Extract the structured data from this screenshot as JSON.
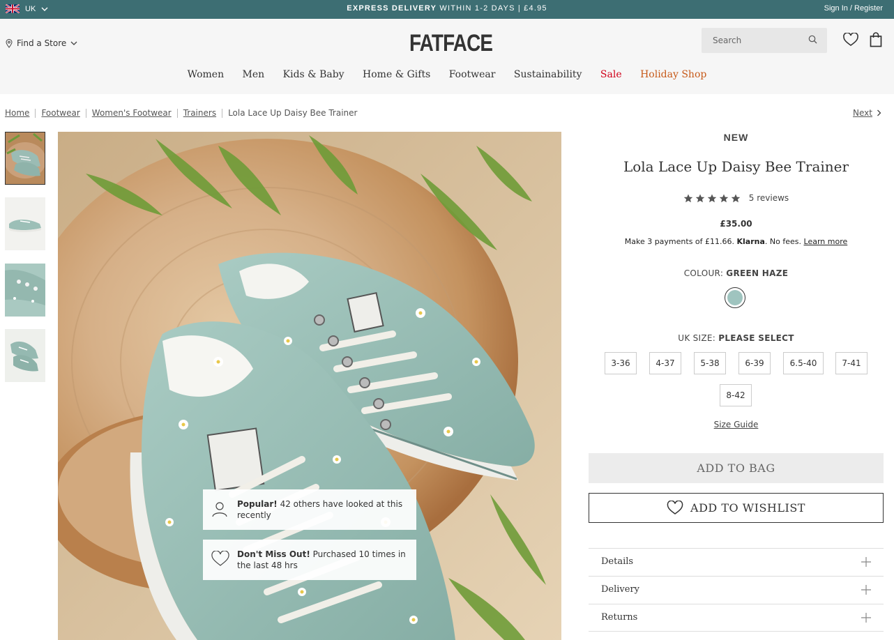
{
  "topbar": {
    "locale": "UK",
    "promo_bold": "EXPRESS DELIVERY",
    "promo_rest": " WITHIN 1-2 DAYS | £4.95",
    "signin": "Sign In / Register"
  },
  "header": {
    "find_store": "Find a Store",
    "logo": "FATFACE",
    "search_placeholder": "Search",
    "nav": [
      "Women",
      "Men",
      "Kids & Baby",
      "Home & Gifts",
      "Footwear",
      "Sustainability",
      "Sale",
      "Holiday Shop"
    ]
  },
  "breadcrumb": {
    "items": [
      "Home",
      "Footwear",
      "Women's Footwear",
      "Trainers",
      "Lola Lace Up Daisy Bee Trainer"
    ],
    "next": "Next"
  },
  "product": {
    "badge": "NEW",
    "title": "Lola Lace Up Daisy Bee Trainer",
    "rating": 5,
    "reviews": "5 reviews",
    "price": "£35.00",
    "klarna_pre": "Make 3 payments of £11.66. ",
    "klarna_brand": "Klarna",
    "klarna_post": ". No fees. ",
    "klarna_link": "Learn more",
    "colour_label": "COLOUR: ",
    "colour_value": "GREEN HAZE",
    "size_label": "UK SIZE: ",
    "size_value": "PLEASE SELECT",
    "sizes": [
      "3-36",
      "4-37",
      "5-38",
      "6-39",
      "6.5-40",
      "7-41",
      "8-42"
    ],
    "size_guide": "Size Guide",
    "add_to_bag": "ADD TO BAG",
    "add_to_wishlist": "ADD TO WISHLIST",
    "accordions": [
      "Details",
      "Delivery",
      "Returns"
    ]
  },
  "popups": {
    "popular_bold": "Popular!",
    "popular_text": " 42 others have looked at this recently",
    "dontmiss_bold": "Don't Miss Out!",
    "dontmiss_text": " Purchased 10 times in the last 48 hrs"
  },
  "colors": {
    "topbar": "#3d6e73",
    "sale": "#d0021b",
    "holiday": "#c75a1a",
    "swatch": "#9fc4bf"
  }
}
